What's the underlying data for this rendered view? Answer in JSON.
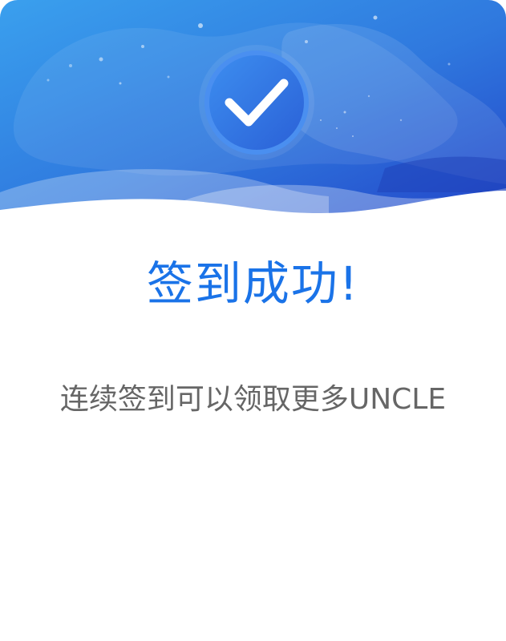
{
  "dialog": {
    "title": "签到成功!",
    "message": "连续签到可以领取更多UNCLE"
  },
  "icons": {
    "status": "checkmark-icon"
  },
  "colors": {
    "title": "#1a73e8",
    "message": "#666666",
    "hero_gradient_start": "#3aa0ee",
    "hero_gradient_end": "#2346c9"
  }
}
